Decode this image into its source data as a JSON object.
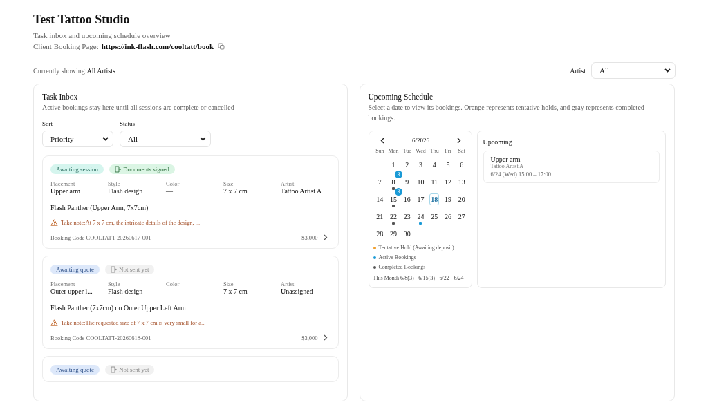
{
  "header": {
    "title": "Test Tattoo Studio",
    "subtitle": "Task inbox and upcoming schedule overview",
    "booking_label": "Client Booking Page:",
    "booking_url": "https://ink-flash.com/cooltatt/book"
  },
  "showing": {
    "label": "Currently showing:",
    "value": "All Artists"
  },
  "artist_filter": {
    "label": "Artist",
    "value": "All"
  },
  "inbox": {
    "title": "Task Inbox",
    "subtitle": "Active bookings stay here until all sessions are complete or cancelled",
    "sort": {
      "label": "Sort",
      "value": "Priority"
    },
    "status": {
      "label": "Status",
      "value": "All"
    },
    "cards": [
      {
        "status": {
          "text": "Awaiting session",
          "kind": "session"
        },
        "document": {
          "text": "Documents signed",
          "kind": "signed"
        },
        "fields": [
          {
            "label": "Placement",
            "value": "Upper arm"
          },
          {
            "label": "Style",
            "value": "Flash design"
          },
          {
            "label": "Color",
            "value": "—"
          },
          {
            "label": "Size",
            "value": "7 x 7 cm"
          },
          {
            "label": "Artist",
            "value": "Tattoo Artist A"
          }
        ],
        "title": "Flash Panther (Upper Arm, 7x7cm)",
        "note": "Take note:At 7 x 7 cm, the intricate details of the design, ...",
        "booking_code": "Booking Code COOLTATT-20260617-001",
        "price": "$3,000"
      },
      {
        "status": {
          "text": "Awaiting quote",
          "kind": "quote"
        },
        "document": {
          "text": "Not sent yet",
          "kind": "unsent"
        },
        "fields": [
          {
            "label": "Placement",
            "value": "Outer upper l..."
          },
          {
            "label": "Style",
            "value": "Flash design"
          },
          {
            "label": "Color",
            "value": "—"
          },
          {
            "label": "Size",
            "value": "7 x 7 cm"
          },
          {
            "label": "Artist",
            "value": "Unassigned"
          }
        ],
        "title": "Flash Panther (7x7cm) on Outer Upper Left Arm",
        "note": "Take note:The requested size of 7 x 7 cm is very small for a...",
        "booking_code": "Booking Code COOLTATT-20260618-001",
        "price": "$3,000"
      },
      {
        "status": {
          "text": "Awaiting quote",
          "kind": "quote"
        },
        "document": {
          "text": "Not sent yet",
          "kind": "unsent"
        }
      }
    ]
  },
  "schedule": {
    "title": "Upcoming Schedule",
    "description": "Select a date to view its bookings. Orange represents tentative holds, and gray represents completed bookings.",
    "calendar": {
      "month": "6/2026",
      "weekdays": [
        "Sun",
        "Mon",
        "Tue",
        "Wed",
        "Thu",
        "Fri",
        "Sat"
      ],
      "days": [
        {
          "day": "1",
          "selected": false
        },
        {
          "day": "2",
          "selected": false
        },
        {
          "day": "3",
          "selected": false
        },
        {
          "day": "4",
          "selected": false
        },
        {
          "day": "5",
          "selected": false
        },
        {
          "day": "6",
          "selected": false
        },
        {
          "day": "7",
          "selected": false
        },
        {
          "day": "8",
          "selected": false,
          "badge": "3",
          "color": "#555555"
        },
        {
          "day": "9",
          "selected": false
        },
        {
          "day": "10",
          "selected": false
        },
        {
          "day": "11",
          "selected": false
        },
        {
          "day": "12",
          "selected": false
        },
        {
          "day": "13",
          "selected": false
        },
        {
          "day": "14",
          "selected": false
        },
        {
          "day": "15",
          "selected": false,
          "badge": "3",
          "color": "#555555"
        },
        {
          "day": "16",
          "selected": false
        },
        {
          "day": "17",
          "selected": false
        },
        {
          "day": "18",
          "selected": true
        },
        {
          "day": "19",
          "selected": false
        },
        {
          "day": "20",
          "selected": false
        },
        {
          "day": "21",
          "selected": false
        },
        {
          "day": "22",
          "selected": false,
          "color": "#555555"
        },
        {
          "day": "23",
          "selected": false
        },
        {
          "day": "24",
          "selected": false,
          "color": "#1a9ad6"
        },
        {
          "day": "25",
          "selected": false
        },
        {
          "day": "26",
          "selected": false
        },
        {
          "day": "27",
          "selected": false
        },
        {
          "day": "28",
          "selected": false
        },
        {
          "day": "29",
          "selected": false
        },
        {
          "day": "30",
          "selected": false
        }
      ],
      "legend": [
        {
          "text": "Tentative Hold (Awaiting deposit)",
          "color": "#f0a030"
        },
        {
          "text": "Active Bookings",
          "color": "#1a9ad6"
        },
        {
          "text": "Completed Bookings",
          "color": "#555555"
        }
      ],
      "summary": "This Month 6/8(3) · 6/15(3) · 6/22 · 6/24"
    },
    "upcoming": {
      "title": "Upcoming",
      "items": [
        {
          "title": "Upper arm",
          "artist": "Tattoo Artist A",
          "time": "6/24 (Wed) 15:00 – 17:00"
        }
      ]
    }
  }
}
